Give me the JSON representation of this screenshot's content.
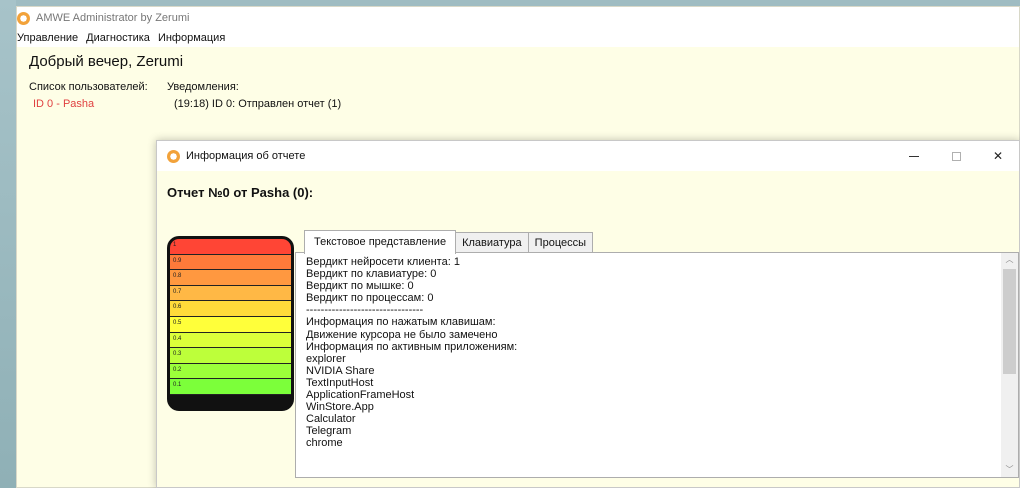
{
  "main_window": {
    "title": "AMWE Administrator by Zerumi",
    "menu": [
      "Управление",
      "Диагностика",
      "Информация"
    ],
    "greeting": "Добрый вечер, Zerumi",
    "users_label": "Список пользователей:",
    "users": [
      "ID 0 - Pasha"
    ],
    "notifications_label": "Уведомления:",
    "notifications": [
      "(19:18) ID 0: Отправлен отчет (1)"
    ]
  },
  "dialog": {
    "title": "Информация об отчете",
    "controls": {
      "minimize": "—",
      "close": "✕"
    },
    "report_title": "Отчет №0 от Pasha (0):",
    "scale": [
      {
        "label": "1",
        "color": "#ff4535"
      },
      {
        "label": "0.9",
        "color": "#ff7a3a"
      },
      {
        "label": "0.8",
        "color": "#ff9840"
      },
      {
        "label": "0.7",
        "color": "#ffb845"
      },
      {
        "label": "0.6",
        "color": "#ffdb3a"
      },
      {
        "label": "0.5",
        "color": "#ffff3a"
      },
      {
        "label": "0.4",
        "color": "#dcff3a"
      },
      {
        "label": "0.3",
        "color": "#bdff3a"
      },
      {
        "label": "0.2",
        "color": "#9cff3a"
      },
      {
        "label": "0.1",
        "color": "#7cff3a"
      }
    ],
    "tabs": [
      {
        "label": "Текстовое представление",
        "active": true
      },
      {
        "label": "Клавиатура",
        "active": false
      },
      {
        "label": "Процессы",
        "active": false
      }
    ],
    "text_lines": [
      "Вердикт нейросети клиента: 1",
      "Вердикт по клавиатуре: 0",
      "Вердикт по мышке: 0",
      "Вердикт по процессам: 0",
      "--------------------------------",
      "Информация по нажатым клавишам:",
      "Движение курсора не было замечено",
      "Информация по активным приложениям:",
      "explorer",
      "NVIDIA Share",
      "TextInputHost",
      "ApplicationFrameHost",
      "WinStore.App",
      "Calculator",
      "Telegram",
      "chrome"
    ]
  }
}
